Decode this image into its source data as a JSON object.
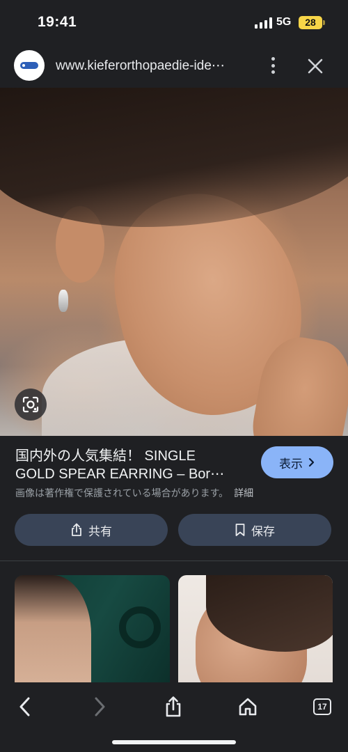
{
  "status_bar": {
    "time": "19:41",
    "network": "5G",
    "battery": "28"
  },
  "browser": {
    "url": "www.kieferorthopaedie-ide⋯",
    "menu_icon": "more-vert-icon",
    "close_icon": "close-icon"
  },
  "result": {
    "title_line1": "国内外の人気集結！ SINGLE",
    "title_line2": "GOLD SPEAR EARRING – Bor⋯",
    "visit_label": "表示",
    "notice": "画像は著作権で保護されている場合があります。",
    "details_label": "詳細"
  },
  "actions": {
    "share_label": "共有",
    "save_label": "保存"
  },
  "toolbar": {
    "tab_count": "17"
  },
  "colors": {
    "accent": "#8ab4f8",
    "action_bg": "#394457",
    "background": "#1f2023",
    "battery": "#f7d548"
  }
}
